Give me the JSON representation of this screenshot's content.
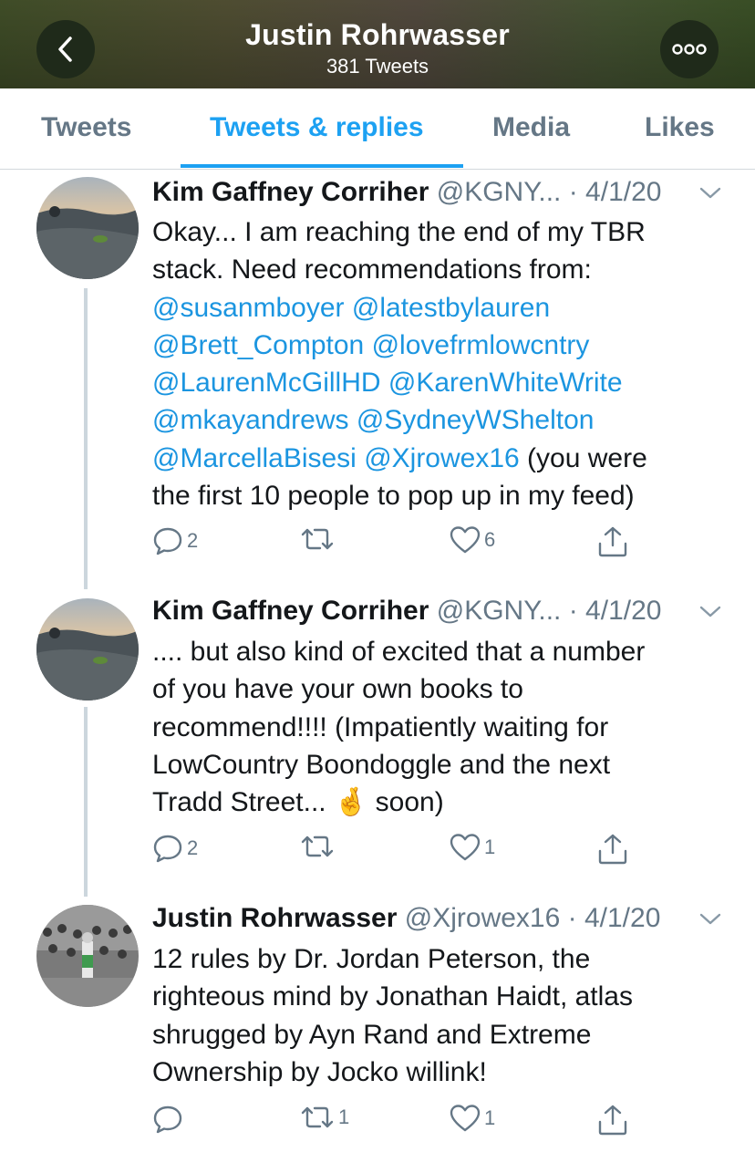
{
  "header": {
    "title": "Justin Rohrwasser",
    "subtitle": "381 Tweets"
  },
  "tabs": [
    {
      "label": "Tweets",
      "active": false
    },
    {
      "label": "Tweets & replies",
      "active": true
    },
    {
      "label": "Media",
      "active": false
    },
    {
      "label": "Likes",
      "active": false
    }
  ],
  "tweets": [
    {
      "name": "Kim Gaffney Corriher",
      "handle": "@KGNY...",
      "date": "· 4/1/20",
      "lines": [
        [
          {
            "t": "Okay... I am reaching the end of my TBR"
          }
        ],
        [
          {
            "t": "stack. Need recommendations from:"
          }
        ],
        [
          {
            "t": "@susanmboyer",
            "m": true
          },
          {
            "t": " "
          },
          {
            "t": "@latestbylauren",
            "m": true
          }
        ],
        [
          {
            "t": "@Brett_Compton",
            "m": true
          },
          {
            "t": " "
          },
          {
            "t": "@lovefrmlowcntry",
            "m": true
          }
        ],
        [
          {
            "t": "@LaurenMcGillHD",
            "m": true
          },
          {
            "t": " "
          },
          {
            "t": "@KarenWhiteWrite",
            "m": true
          }
        ],
        [
          {
            "t": "@mkayandrews",
            "m": true
          },
          {
            "t": " "
          },
          {
            "t": "@SydneyWShelton",
            "m": true
          }
        ],
        [
          {
            "t": "@MarcellaBisesi",
            "m": true
          },
          {
            "t": " "
          },
          {
            "t": "@Xjrowex16",
            "m": true
          },
          {
            "t": " (you were"
          }
        ],
        [
          {
            "t": "the first 10 people to pop up in my feed)"
          }
        ]
      ],
      "replies": "2",
      "retweets": "",
      "likes": "6"
    },
    {
      "name": "Kim Gaffney Corriher",
      "handle": "@KGNY...",
      "date": "· 4/1/20",
      "lines": [
        [
          {
            "t": ".... but also kind of excited that a number"
          }
        ],
        [
          {
            "t": "of you have your own books to"
          }
        ],
        [
          {
            "t": "recommend!!!! (Impatiently waiting for"
          }
        ],
        [
          {
            "t": "LowCountry Boondoggle and the next"
          }
        ],
        [
          {
            "t": "Tradd Street... "
          },
          {
            "t": "🤞",
            "e": true
          },
          {
            "t": " soon)"
          }
        ]
      ],
      "replies": "2",
      "retweets": "",
      "likes": "1"
    },
    {
      "name": "Justin Rohrwasser",
      "handle": "@Xjrowex16",
      "date": "· 4/1/20",
      "lines": [
        [
          {
            "t": "12 rules by Dr. Jordan Peterson, the"
          }
        ],
        [
          {
            "t": "righteous mind by Jonathan Haidt, atlas"
          }
        ],
        [
          {
            "t": "shrugged by Ayn Rand and Extreme"
          }
        ],
        [
          {
            "t": "Ownership by Jocko willink!"
          }
        ]
      ],
      "replies": "",
      "retweets": "1",
      "likes": "1"
    }
  ],
  "icons": {
    "back": "chevron-left-icon",
    "more": "more-dots-icon",
    "caret": "chevron-down-icon",
    "reply": "reply-icon",
    "retweet": "retweet-icon",
    "like": "heart-icon",
    "share": "share-icon"
  },
  "colors": {
    "accent": "#1da1f2",
    "mention": "#1b95e0",
    "muted": "#657786",
    "text": "#14171a"
  }
}
